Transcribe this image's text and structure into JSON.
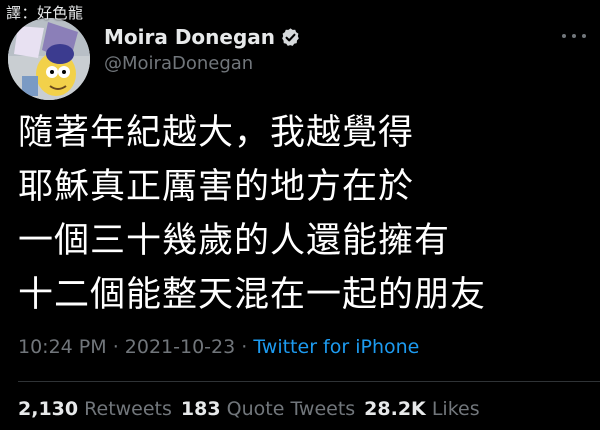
{
  "watermark": "譯：好色龍",
  "author": {
    "display_name": "Moira Donegan",
    "handle": "@MoiraDonegan",
    "verified": true
  },
  "tweet": {
    "lines": [
      "隨著年紀越大，我越覺得",
      "耶穌真正厲害的地方在於",
      "一個三十幾歲的人還能擁有",
      "十二個能整天混在一起的朋友"
    ]
  },
  "meta": {
    "time": "10:24 PM",
    "separator1": " · ",
    "date": "2021-10-23",
    "separator2": " · ",
    "source": "Twitter for iPhone"
  },
  "stats": {
    "retweets": {
      "count": "2,130",
      "label": "Retweets"
    },
    "quotes": {
      "count": "183",
      "label": "Quote Tweets"
    },
    "likes": {
      "count": "28.2K",
      "label": "Likes"
    }
  },
  "colors": {
    "background": "#000000",
    "text": "#e7e9ea",
    "secondary": "#71767b",
    "link": "#1d9bf0",
    "verified": "#d6d9db"
  },
  "icons": {
    "verified": "verified-badge-icon",
    "more": "more-horizontal-icon"
  }
}
